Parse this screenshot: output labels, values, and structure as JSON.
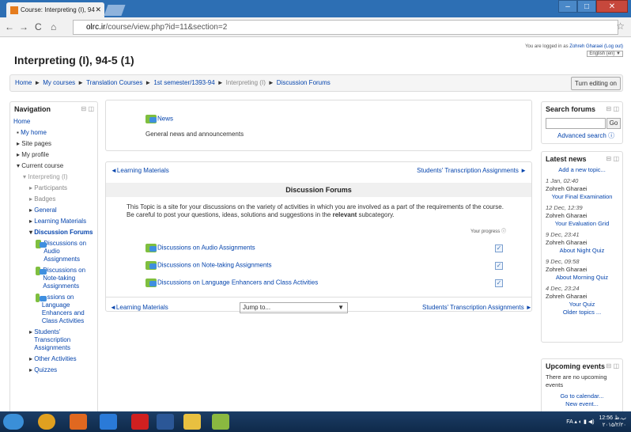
{
  "tab": {
    "title": "Course: Interpreting (I), 94"
  },
  "url": {
    "host": "olrc.ir",
    "path": "/course/view.php?id=11&section=2"
  },
  "course_title": "Interpreting (I), 94-5 (1)",
  "login": {
    "text": "You are logged in as",
    "user": "Zohreh Gharaei",
    "logout": "(Log out)",
    "lang": "English (en) ▼"
  },
  "breadcrumb": {
    "items": [
      "Home",
      "My courses",
      "Translation Courses",
      "1st semester/1393-94",
      "Interpreting (I)",
      "Discussion Forums"
    ]
  },
  "turn_editing": "Turn editing on",
  "navigation": {
    "title": "Navigation",
    "items": [
      "Home",
      "My home",
      "Site pages",
      "My profile",
      "Current course",
      "Interpreting (I)",
      "Participants",
      "Badges",
      "General",
      "Learning Materials",
      "Discussion Forums",
      "Discussions on Audio Assignments",
      "Discussions on Note-taking Assignments",
      "...ssions on Language Enhancers and Class Activities",
      "Students' Transcription Assignments",
      "Other Activities",
      "Quizzes"
    ]
  },
  "news_section": {
    "link": "News",
    "desc": "General news and announcements"
  },
  "section": {
    "prev": "◄Learning Materials",
    "next": "Students' Transcription Assignments ►",
    "title": "Discussion Forums",
    "summary_1": "This Topic is a site for your discussions on the variety of activities in which you are involved as a part of the requirements of the course. Be careful to post your questions, ideas, solutions and suggestions in the ",
    "summary_bold": "relevant",
    "summary_2": " subcategory.",
    "progress": "Your progress",
    "forums": [
      "Discussions on Audio Assignments",
      "Discussions on Note-taking Assignments",
      "Discussions on Language Enhancers and Class Activities"
    ],
    "jump": "Jump to..."
  },
  "search": {
    "title": "Search forums",
    "go": "Go",
    "advanced": "Advanced search"
  },
  "latest_news": {
    "title": "Latest news",
    "add": "Add a new topic...",
    "items": [
      {
        "date": "1 Jan, 02:40",
        "author": "Zohreh Gharaei",
        "subject": "Your Final Examination"
      },
      {
        "date": "12 Dec, 12:39",
        "author": "Zohreh Gharaei",
        "subject": "Your Evaluation Grid"
      },
      {
        "date": "9 Dec, 23:41",
        "author": "Zohreh Gharaei",
        "subject": "About Night Quiz"
      },
      {
        "date": "9 Dec, 09:58",
        "author": "Zohreh Gharaei",
        "subject": "About Morning Quiz"
      },
      {
        "date": "4 Dec, 23:24",
        "author": "Zohreh Gharaei",
        "subject": "Your Quiz"
      }
    ],
    "older": "Older topics ..."
  },
  "upcoming": {
    "title": "Upcoming events",
    "text": "There are no upcoming events",
    "calendar": "Go to calendar...",
    "new": "New event..."
  },
  "tray": {
    "lang": "FA",
    "time": "12:56 ب.ظ",
    "date": "۲۰۱۵/۲/۲۰"
  }
}
